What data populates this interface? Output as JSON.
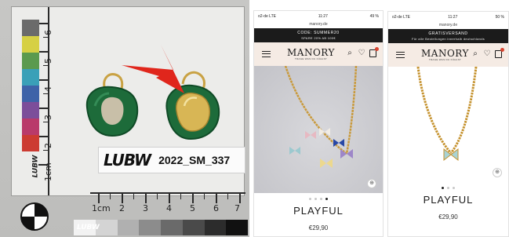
{
  "evidence_photo": {
    "sample_id": "2022_SM_337",
    "lab_logo": "LUBW",
    "ruler_vertical_labels": [
      "6",
      "5",
      "4",
      "3",
      "2",
      "1cm"
    ],
    "ruler_horizontal_labels": [
      "1cm",
      "2",
      "3",
      "4",
      "5",
      "6",
      "7"
    ]
  },
  "phone_left": {
    "status": {
      "carrier": "o2-de  LTE",
      "time": "11:27",
      "battery": "49 %"
    },
    "url": "manory.de",
    "promo_line1": "CODE: SUMMER20",
    "promo_line2": "SPARE 20% AB 100€",
    "brand": "MANORY",
    "tagline": "TRAGE WAS DU FÜHLST",
    "product_name": "PLAYFUL",
    "price": "€29,90",
    "gallery": {
      "count": 4,
      "active": 3
    }
  },
  "phone_right": {
    "status": {
      "carrier": "o2-de  LTE",
      "time": "11:27",
      "battery": "50 %"
    },
    "url": "manory.de",
    "promo_line1": "GRATISVERSAND",
    "promo_line2": "Für alle Bestellungen innerhalb deutschlands",
    "brand": "MANORY",
    "tagline": "TRAGE WAS DU FÜHLST",
    "product_name": "PLAYFUL",
    "price": "€29,90",
    "gallery": {
      "count": 3,
      "active": 0
    }
  },
  "colors": {
    "earring_green": "#1d6b3a",
    "gold": "#c9a244",
    "arrow_red": "#e0261c",
    "header_bg": "#f5ebe4",
    "promo_bg": "#1b1b1b"
  }
}
